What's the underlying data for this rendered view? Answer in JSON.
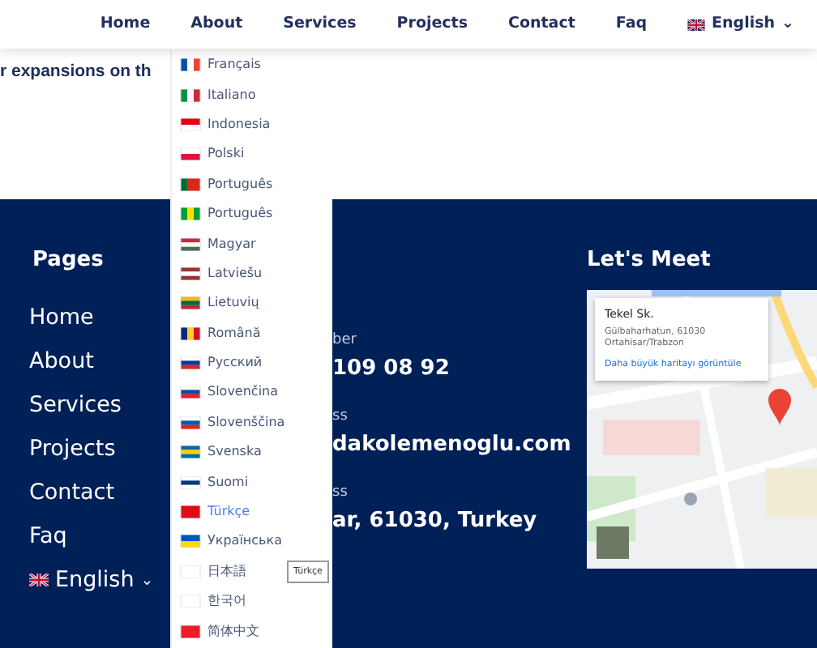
{
  "navbar": {
    "links": [
      "Home",
      "About",
      "Services",
      "Projects",
      "Contact",
      "Faq"
    ],
    "language": {
      "label": "English",
      "caret": "⌄"
    }
  },
  "hero": {
    "heading": "r expansions on th"
  },
  "language_menu": [
    {
      "label": "Français",
      "hovered": false
    },
    {
      "label": "Italiano",
      "hovered": false
    },
    {
      "label": "Indonesia",
      "hovered": false
    },
    {
      "label": "Polski",
      "hovered": false
    },
    {
      "label": "Português",
      "hovered": false
    },
    {
      "label": "Português",
      "hovered": false
    },
    {
      "label": "Magyar",
      "hovered": false
    },
    {
      "label": "Latviešu",
      "hovered": false
    },
    {
      "label": "Lietuvių",
      "hovered": false
    },
    {
      "label": "Română",
      "hovered": false
    },
    {
      "label": "Русский",
      "hovered": false
    },
    {
      "label": "Slovenčina",
      "hovered": false
    },
    {
      "label": "Slovenščina",
      "hovered": false
    },
    {
      "label": "Svenska",
      "hovered": false
    },
    {
      "label": "Suomi",
      "hovered": false
    },
    {
      "label": "Türkçe",
      "hovered": true
    },
    {
      "label": "Українська",
      "hovered": false
    },
    {
      "label": "日本語",
      "hovered": false
    },
    {
      "label": "한국어",
      "hovered": false
    },
    {
      "label": "简体中文",
      "hovered": false
    }
  ],
  "tooltip": "Türkçe",
  "footer": {
    "pages": {
      "title": "Pages",
      "links": [
        "Home",
        "About",
        "Services",
        "Projects",
        "Contact",
        "Faq"
      ],
      "language": {
        "label": "English",
        "caret": "⌄"
      }
    },
    "contact": [
      {
        "label": "ber",
        "value": "109 08 92"
      },
      {
        "label": "ss",
        "value": "dakolemenoglu.com"
      },
      {
        "label": "ss",
        "value": "ar, 61030, Turkey"
      }
    ],
    "meet": {
      "title": "Let's Meet",
      "map_card": {
        "title": "Tekel Sk.",
        "address": [
          "Gülbaharhatun, 61030",
          "Ortahisar/Trabzon"
        ],
        "link": "Daha büyük haritayı görüntüle"
      }
    }
  }
}
